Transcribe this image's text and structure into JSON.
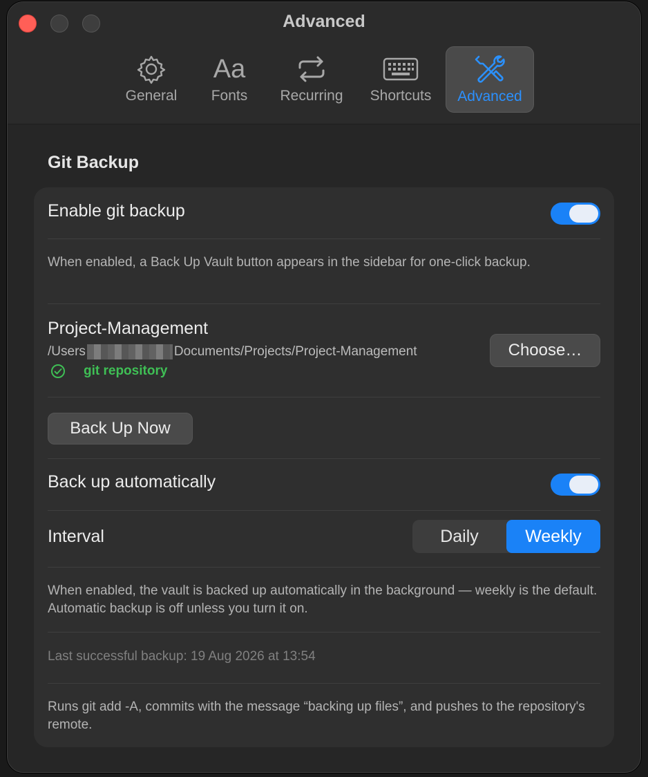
{
  "window": {
    "title": "Advanced"
  },
  "tabs": [
    {
      "label": "General",
      "icon": "gear-icon"
    },
    {
      "label": "Fonts",
      "icon": "fonts-icon",
      "glyph": "Aa"
    },
    {
      "label": "Recurring",
      "icon": "repeat-icon"
    },
    {
      "label": "Shortcuts",
      "icon": "keyboard-icon"
    },
    {
      "label": "Advanced",
      "icon": "tools-icon",
      "active": true
    }
  ],
  "git_backup": {
    "section_title": "Git Backup",
    "enable_label": "Enable git backup",
    "enable_on": true,
    "enable_desc": "When enabled, a Back Up Vault button appears in the sidebar for one-click backup.",
    "repo_name": "Project-Management",
    "repo_path_prefix": "/Users",
    "repo_path_suffix": "Documents/Projects/Project-Management",
    "repo_status": "git repository",
    "choose_label": "Choose…",
    "backup_now_label": "Back Up Now",
    "auto_label": "Back up automatically",
    "auto_on": true,
    "interval_label": "Interval",
    "interval_options": [
      "Daily",
      "Weekly"
    ],
    "interval_selected": "Weekly",
    "auto_desc": "When enabled, the vault is backed up automatically in the background — weekly is the default. Automatic backup is off unless you turn it on.",
    "last_backup": "Last successful backup: 19 Aug 2026 at 13:54",
    "footer_desc": "Runs git add -A, commits with the message “backing up files”, and pushes to the repository's remote."
  },
  "colors": {
    "accent": "#1a82f7",
    "success": "#3fbf55",
    "close": "#ff5f57"
  }
}
